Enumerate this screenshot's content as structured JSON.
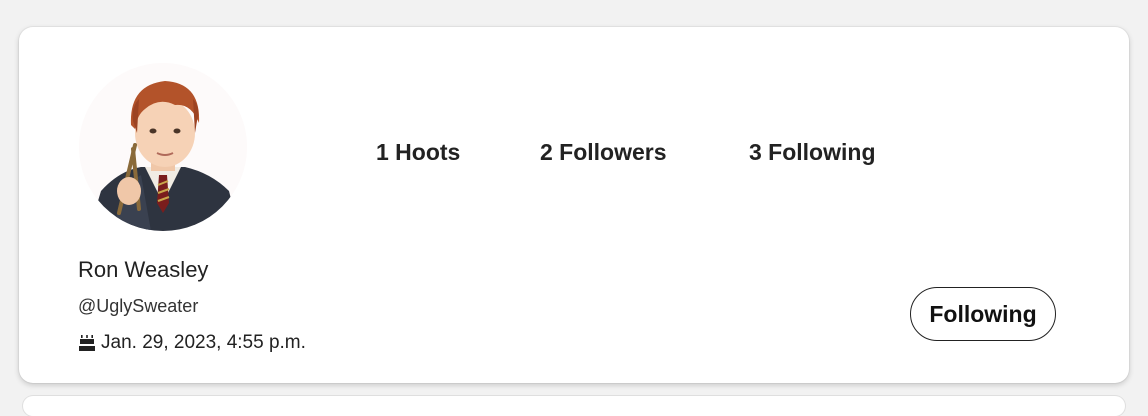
{
  "profile": {
    "avatar_alt": "profile-photo",
    "display_name": "Ron Weasley",
    "handle": "@UglySweater",
    "joined": "Jan. 29, 2023, 4:55 p.m."
  },
  "stats": {
    "hoots": "1 Hoots",
    "followers": "2 Followers",
    "following": "3 Following"
  },
  "actions": {
    "follow_button_label": "Following"
  },
  "icons": {
    "joined_icon": "birthday-cake-icon"
  },
  "colors": {
    "card_bg": "#ffffff",
    "page_bg": "#f2f2f2",
    "text": "#222222",
    "button_border": "#222222"
  }
}
